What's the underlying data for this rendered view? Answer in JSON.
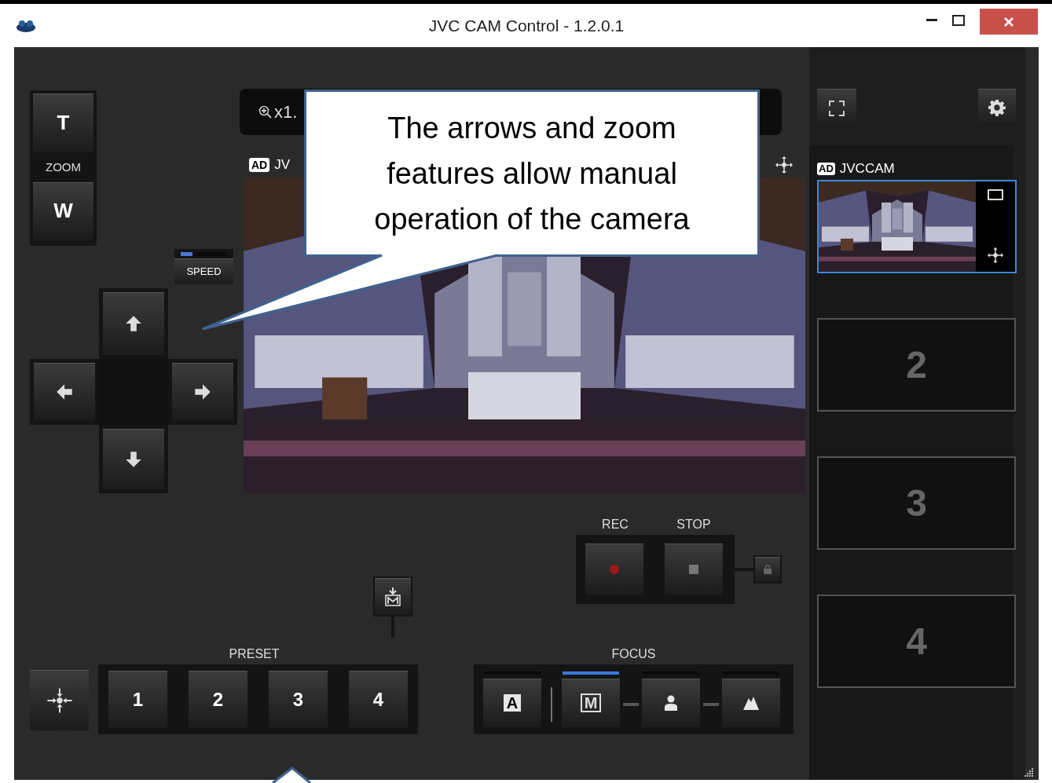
{
  "window": {
    "title": "JVC CAM Control - 1.2.0.1"
  },
  "zoom": {
    "tele": "T",
    "label": "ZOOM",
    "wide": "W"
  },
  "speed": {
    "label": "SPEED",
    "level": 0.25
  },
  "viewer": {
    "zoom_readout": "x1.",
    "badge": "AD",
    "camera_label": "JV"
  },
  "record": {
    "rec_label": "REC",
    "stop_label": "STOP"
  },
  "preset": {
    "label": "PRESET",
    "buttons": [
      "1",
      "2",
      "3",
      "4"
    ]
  },
  "focus": {
    "label": "FOCUS",
    "modes": [
      {
        "kind": "auto",
        "label": "A",
        "selected": false
      },
      {
        "kind": "manual",
        "label": "M",
        "selected": true
      },
      {
        "kind": "person",
        "selected": false
      },
      {
        "kind": "landscape",
        "selected": false
      }
    ]
  },
  "cameras": [
    {
      "kind": "live",
      "badge": "AD",
      "name": "JVCCAM",
      "selected": true
    },
    {
      "kind": "empty",
      "label": "2",
      "selected": false
    },
    {
      "kind": "empty",
      "label": "3",
      "selected": false
    },
    {
      "kind": "empty",
      "label": "4",
      "selected": false
    }
  ],
  "callout": {
    "text": "The arrows and zoom features allow manual operation of the camera"
  }
}
